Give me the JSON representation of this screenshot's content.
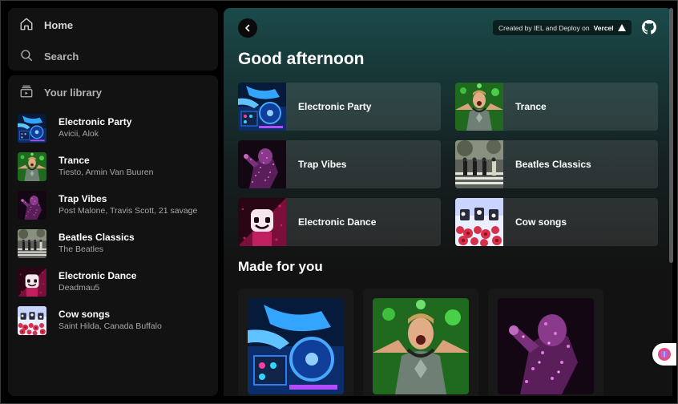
{
  "nav": {
    "home_label": "Home",
    "search_label": "Search"
  },
  "library": {
    "header": "Your library",
    "items": [
      {
        "title": "Electronic Party",
        "subtitle": "Avicii, Alok",
        "art": "dj-deck"
      },
      {
        "title": "Trance",
        "subtitle": "Tiesto, Armin Van Buuren",
        "art": "dj-green"
      },
      {
        "title": "Trap Vibes",
        "subtitle": "Post Malone, Travis Scott, 21 savage",
        "art": "purple-glitter"
      },
      {
        "title": "Beatles Classics",
        "subtitle": "The Beatles",
        "art": "abbey-road"
      },
      {
        "title": "Electronic Dance",
        "subtitle": "Deadmau5",
        "art": "marshmello"
      },
      {
        "title": "Cow songs",
        "subtitle": "Saint Hilda, Canada Buffalo",
        "art": "cows"
      }
    ]
  },
  "header": {
    "credit_prefix": "Created by IEL and Deploy on",
    "credit_brand": "Vercel",
    "github_icon": "github-icon",
    "back_icon": "chevron-left-icon"
  },
  "main": {
    "greeting": "Good afternoon",
    "quick": [
      {
        "label": "Electronic Party",
        "art": "dj-deck"
      },
      {
        "label": "Trance",
        "art": "dj-green"
      },
      {
        "label": "Trap Vibes",
        "art": "purple-glitter"
      },
      {
        "label": "Beatles Classics",
        "art": "abbey-road"
      },
      {
        "label": "Electronic Dance",
        "art": "marshmello"
      },
      {
        "label": "Cow songs",
        "art": "cows"
      }
    ],
    "made_for_you_title": "Made for you",
    "made_for_you": [
      {
        "art": "dj-deck"
      },
      {
        "art": "dj-green"
      },
      {
        "art": "purple-glitter"
      }
    ]
  },
  "colors": {
    "accent_teal": "#1b4a4a",
    "panel": "#121212",
    "card": "#181818"
  }
}
